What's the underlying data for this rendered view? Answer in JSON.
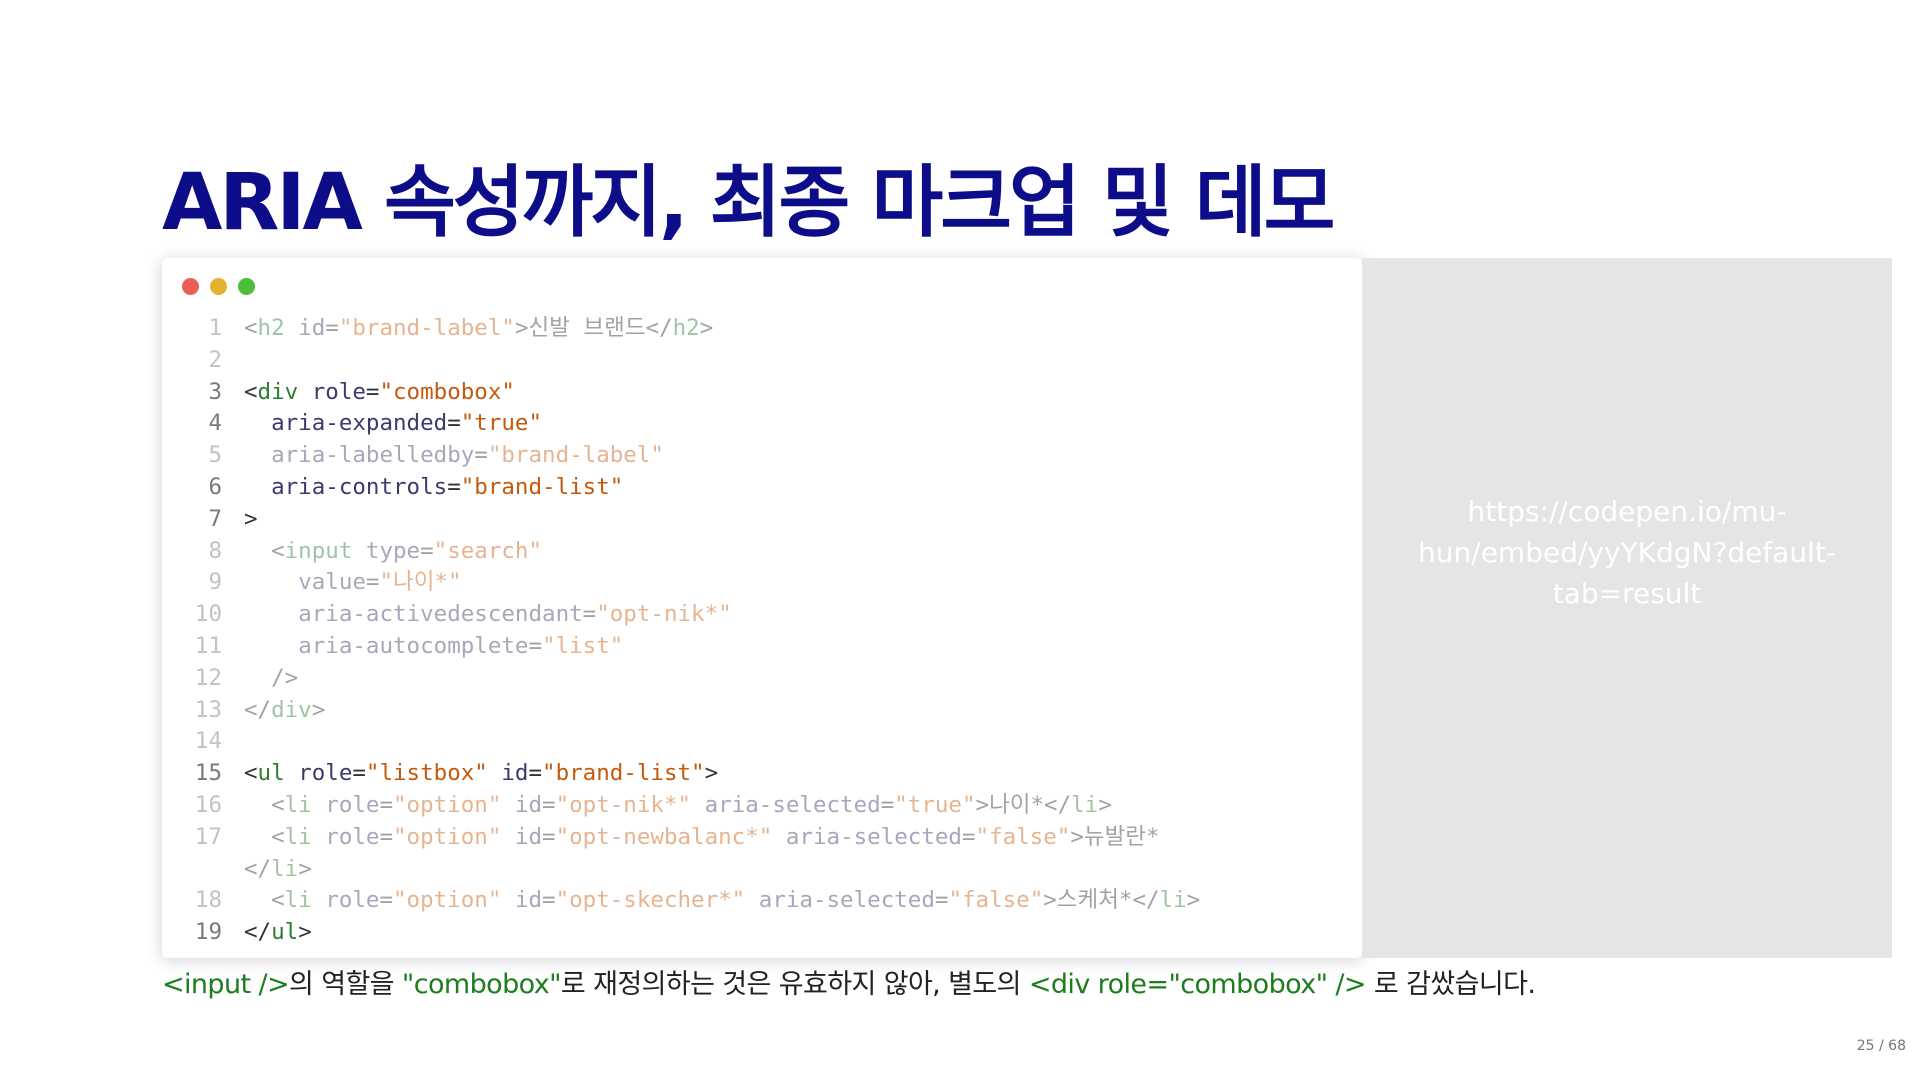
{
  "slide": {
    "title": "ARIA 속성까지, 최종 마크업 및 데모",
    "page_number": "25 / 68"
  },
  "window_dots": {
    "colors": [
      "#ec5f57",
      "#e3b32f",
      "#4cbf38"
    ]
  },
  "code": {
    "lines": [
      {
        "n": "1",
        "dim": true,
        "tokens": [
          [
            "p",
            "<"
          ],
          [
            "tag",
            "h2"
          ],
          [
            "p",
            " "
          ],
          [
            "attr",
            "id"
          ],
          [
            "p",
            "="
          ],
          [
            "str",
            "\"brand-label\""
          ],
          [
            "p",
            ">신발 브랜드</"
          ],
          [
            "tag",
            "h2"
          ],
          [
            "p",
            ">"
          ]
        ]
      },
      {
        "n": "2",
        "dim": true,
        "tokens": []
      },
      {
        "n": "3",
        "dim": false,
        "tokens": [
          [
            "p",
            "<"
          ],
          [
            "tag",
            "div"
          ],
          [
            "p",
            " "
          ],
          [
            "attr",
            "role"
          ],
          [
            "p",
            "="
          ],
          [
            "str",
            "\"combobox\""
          ]
        ]
      },
      {
        "n": "4",
        "dim": false,
        "tokens": [
          [
            "p",
            "  "
          ],
          [
            "attr",
            "aria-expanded"
          ],
          [
            "p",
            "="
          ],
          [
            "str",
            "\"true\""
          ]
        ]
      },
      {
        "n": "5",
        "dim": true,
        "tokens": [
          [
            "p",
            "  "
          ],
          [
            "attr",
            "aria-labelledby"
          ],
          [
            "p",
            "="
          ],
          [
            "str",
            "\"brand-label\""
          ]
        ]
      },
      {
        "n": "6",
        "dim": false,
        "tokens": [
          [
            "p",
            "  "
          ],
          [
            "attr",
            "aria-controls"
          ],
          [
            "p",
            "="
          ],
          [
            "str",
            "\"brand-list\""
          ]
        ]
      },
      {
        "n": "7",
        "dim": false,
        "tokens": [
          [
            "p",
            ">"
          ]
        ]
      },
      {
        "n": "8",
        "dim": true,
        "tokens": [
          [
            "p",
            "  <"
          ],
          [
            "tag",
            "input"
          ],
          [
            "p",
            " "
          ],
          [
            "attr",
            "type"
          ],
          [
            "p",
            "="
          ],
          [
            "str",
            "\"search\""
          ]
        ]
      },
      {
        "n": "9",
        "dim": true,
        "tokens": [
          [
            "p",
            "    "
          ],
          [
            "attr",
            "value"
          ],
          [
            "p",
            "="
          ],
          [
            "str",
            "\"나이*\""
          ]
        ]
      },
      {
        "n": "10",
        "dim": true,
        "tokens": [
          [
            "p",
            "    "
          ],
          [
            "attr",
            "aria-activedescendant"
          ],
          [
            "p",
            "="
          ],
          [
            "str",
            "\"opt-nik*\""
          ]
        ]
      },
      {
        "n": "11",
        "dim": true,
        "tokens": [
          [
            "p",
            "    "
          ],
          [
            "attr",
            "aria-autocomplete"
          ],
          [
            "p",
            "="
          ],
          [
            "str",
            "\"list\""
          ]
        ]
      },
      {
        "n": "12",
        "dim": true,
        "tokens": [
          [
            "p",
            "  />"
          ]
        ]
      },
      {
        "n": "13",
        "dim": true,
        "tokens": [
          [
            "p",
            "</"
          ],
          [
            "tag",
            "div"
          ],
          [
            "p",
            ">"
          ]
        ]
      },
      {
        "n": "14",
        "dim": true,
        "tokens": []
      },
      {
        "n": "15",
        "dim": false,
        "tokens": [
          [
            "p",
            "<"
          ],
          [
            "tag",
            "ul"
          ],
          [
            "p",
            " "
          ],
          [
            "attr",
            "role"
          ],
          [
            "p",
            "="
          ],
          [
            "str",
            "\"listbox\""
          ],
          [
            "p",
            " "
          ],
          [
            "attr",
            "id"
          ],
          [
            "p",
            "="
          ],
          [
            "str",
            "\"brand-list\""
          ],
          [
            "p",
            ">"
          ]
        ]
      },
      {
        "n": "16",
        "dim": true,
        "tokens": [
          [
            "p",
            "  <"
          ],
          [
            "tag",
            "li"
          ],
          [
            "p",
            " "
          ],
          [
            "attr",
            "role"
          ],
          [
            "p",
            "="
          ],
          [
            "str",
            "\"option\""
          ],
          [
            "p",
            " "
          ],
          [
            "attr",
            "id"
          ],
          [
            "p",
            "="
          ],
          [
            "str",
            "\"opt-nik*\""
          ],
          [
            "p",
            " "
          ],
          [
            "attr",
            "aria-selected"
          ],
          [
            "p",
            "="
          ],
          [
            "str",
            "\"true\""
          ],
          [
            "p",
            ">나이*</"
          ],
          [
            "tag",
            "li"
          ],
          [
            "p",
            ">"
          ]
        ]
      },
      {
        "n": "17",
        "dim": true,
        "tokens": [
          [
            "p",
            "  <"
          ],
          [
            "tag",
            "li"
          ],
          [
            "p",
            " "
          ],
          [
            "attr",
            "role"
          ],
          [
            "p",
            "="
          ],
          [
            "str",
            "\"option\""
          ],
          [
            "p",
            " "
          ],
          [
            "attr",
            "id"
          ],
          [
            "p",
            "="
          ],
          [
            "str",
            "\"opt-newbalanc*\""
          ],
          [
            "p",
            " "
          ],
          [
            "attr",
            "aria-selected"
          ],
          [
            "p",
            "="
          ],
          [
            "str",
            "\"false\""
          ],
          [
            "p",
            ">뉴발란*"
          ]
        ]
      },
      {
        "n": "",
        "dim": true,
        "tokens": [
          [
            "p",
            "</"
          ],
          [
            "tag",
            "li"
          ],
          [
            "p",
            ">"
          ]
        ]
      },
      {
        "n": "18",
        "dim": true,
        "tokens": [
          [
            "p",
            "  <"
          ],
          [
            "tag",
            "li"
          ],
          [
            "p",
            " "
          ],
          [
            "attr",
            "role"
          ],
          [
            "p",
            "="
          ],
          [
            "str",
            "\"option\""
          ],
          [
            "p",
            " "
          ],
          [
            "attr",
            "id"
          ],
          [
            "p",
            "="
          ],
          [
            "str",
            "\"opt-skecher*\""
          ],
          [
            "p",
            " "
          ],
          [
            "attr",
            "aria-selected"
          ],
          [
            "p",
            "="
          ],
          [
            "str",
            "\"false\""
          ],
          [
            "p",
            ">스케처*</"
          ],
          [
            "tag",
            "li"
          ],
          [
            "p",
            ">"
          ]
        ]
      },
      {
        "n": "19",
        "dim": false,
        "tokens": [
          [
            "p",
            "</"
          ],
          [
            "tag",
            "ul"
          ],
          [
            "p",
            ">"
          ]
        ]
      }
    ]
  },
  "embed": {
    "url": "https://codepen.io/mu-hun/embed/yyYKdgN?default-tab=result"
  },
  "caption": {
    "code1": "<input />",
    "text1": "의 역할을 ",
    "code2": "\"combobox\"",
    "text2": "로 재정의하는 것은 유효하지 않아, 별도의 ",
    "code3": "<div role=\"combobox\" />",
    "text3": " 로 감쌌습니다."
  }
}
